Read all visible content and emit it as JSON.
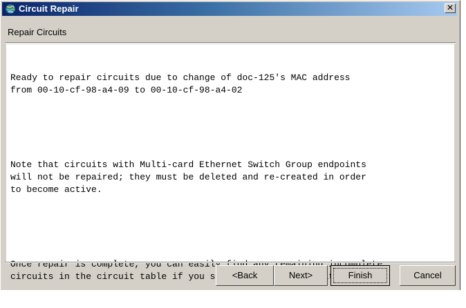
{
  "window": {
    "title": "Circuit Repair",
    "close_glyph": "✕"
  },
  "section": {
    "label": "Repair Circuits"
  },
  "message": {
    "paragraphs": [
      "Ready to repair circuits due to change of doc-125's MAC address\nfrom 00-10-cf-98-a4-09 to 00-10-cf-98-a4-02",
      "Note that circuits with Multi-card Ethernet Switch Group endpoints\nwill not be repaired; they must be deleted and re-created in order\nto become active.",
      "Once repair is complete, you can easily find any remaining incomplete\ncircuits in the circuit table if you sort it by circuit state."
    ]
  },
  "buttons": {
    "back": "<Back",
    "next": "Next>",
    "finish": "Finish",
    "cancel": "Cancel"
  },
  "icons": {
    "title_icon": "circuit-globe-icon",
    "close_icon": "close-icon"
  },
  "colors": {
    "titlebar_start": "#0a246a",
    "titlebar_end": "#a6caf0",
    "dialog_face": "#d4d0c8",
    "content_background": "#ffffff"
  }
}
